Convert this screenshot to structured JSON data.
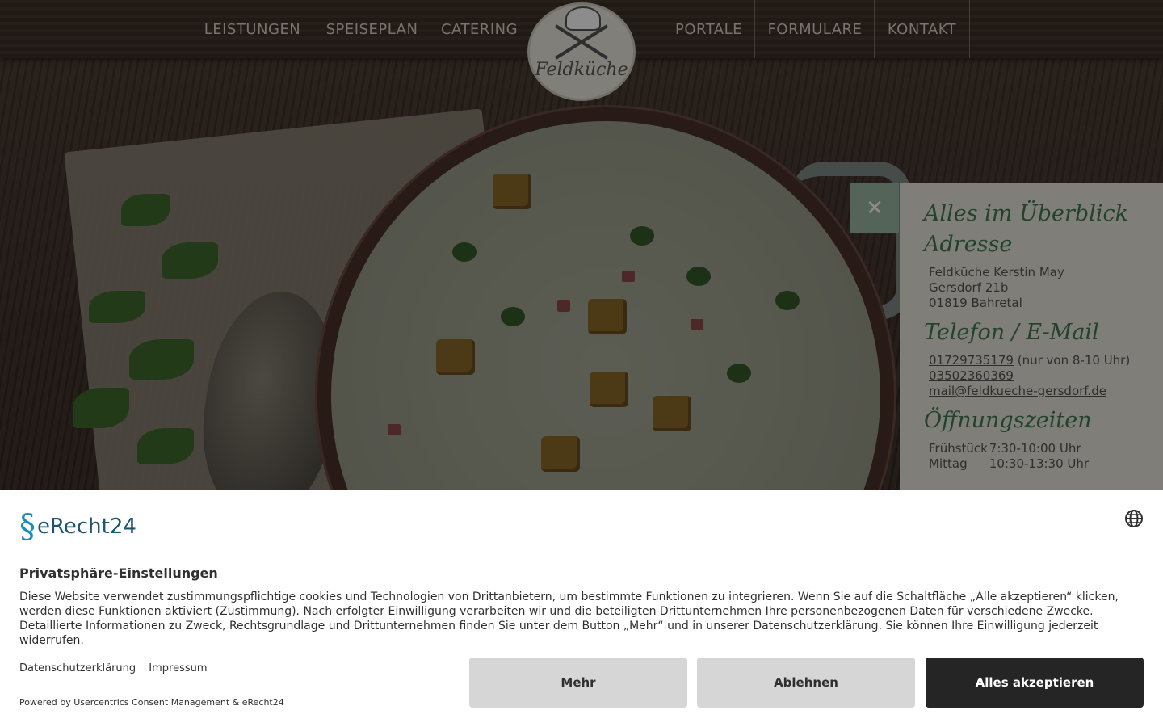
{
  "nav": {
    "left": [
      "LEISTUNGEN",
      "SPEISEPLAN",
      "CATERING"
    ],
    "right": [
      "PORTALE",
      "FORMULARE",
      "KONTAKT"
    ],
    "logo_text": "Feldküche"
  },
  "info": {
    "close_icon": "✕",
    "title": "Alles im Überblick",
    "address_heading": "Adresse",
    "address_lines": [
      "Feldküche Kerstin May",
      "Gersdorf 21b",
      "01819 Bahretal"
    ],
    "contact_heading": "Telefon / E-Mail",
    "phone_1": "01729735179",
    "phone_1_note": " (nur von 8-10 Uhr)",
    "phone_2": "03502360369",
    "email": "mail@feldkueche-gersdorf.de",
    "hours_heading": "Öffnungszeiten",
    "hours": [
      {
        "label": "Frühstück",
        "time": "7:30-10:00 Uhr"
      },
      {
        "label": "Mittag",
        "time": "10:30-13:30 Uhr"
      }
    ]
  },
  "consent": {
    "brand": "eRecht24",
    "globe_icon": "globe-icon",
    "title": "Privatsphäre-Einstellungen",
    "body": "Diese Website verwendet zustimmungspflichtige cookies und Technologien von Drittanbietern, um bestimmte Funktionen zu integrieren. Wenn Sie auf die Schaltfläche „Alle akzeptieren“ klicken, werden diese Funktionen aktiviert (Zustimmung). Nach erfolgter Einwilligung verarbeiten wir und die beteiligten Drittunternehmen Ihre personenbezogenen Daten für verschiedene Zwecke. Detaillierte Informationen zu Zweck, Rechtsgrundlage und Drittunternehmen finden Sie unter dem Button „Mehr“ und in unserer Datenschutzerklärung. Sie können Ihre Einwilligung jederzeit widerrufen.",
    "link_privacy": "Datenschutzerklärung",
    "link_imprint": "Impressum",
    "powered": "Powered by Usercentrics Consent Management & eRecht24",
    "btn_more": "Mehr",
    "btn_decline": "Ablehnen",
    "btn_accept": "Alles akzeptieren"
  },
  "colors": {
    "accent_green": "#3f7a4d",
    "close_green": "#9bb7a0",
    "brand_blue": "#1b5570",
    "dark_button": "#252525"
  }
}
